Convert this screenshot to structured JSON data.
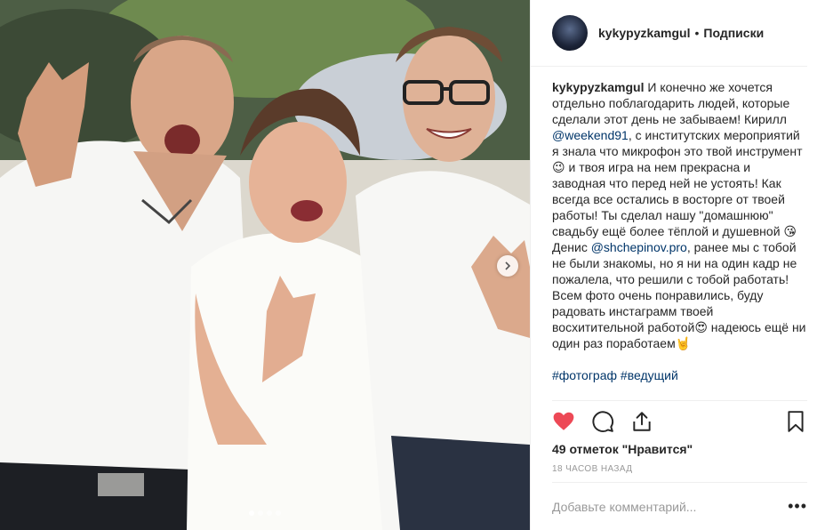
{
  "header": {
    "username": "kykypyzkamgul",
    "separator": "•",
    "follow_label": "Подписки"
  },
  "caption": {
    "username": "kykypyzkamgul",
    "part1": " И конечно же хочется отдельно поблагодарить людей, которые сделали этот день не забываем! Кирилл ",
    "mention1": "@weekend91",
    "part2": ", с институтских мероприятий я знала что микрофон это твой инструмент😉 и твоя игра на нем прекрасна и заводная что перед ней не устоять! Как всегда все остались в восторге от твоей работы! Ты сделал нашу \"домашнюю\" свадьбу ещё более тёплой и душевной 😘\nДенис ",
    "mention2": "@shchepinov.pro",
    "part3": ", ранее мы с тобой не были знакомы, но я ни на один кадр не пожалела, что решили с тобой работать! Всем фото очень понравились, буду радовать инстаграмм твоей восхитительной работой😍 надеюсь ещё ни один раз поработаем🤘\n\n",
    "hashtags": "#фотограф #ведущий"
  },
  "actions": {
    "like_icon": "heart-filled-icon",
    "comment_icon": "comment-bubble-icon",
    "share_icon": "share-icon",
    "save_icon": "bookmark-icon",
    "like_color": "#ed4956"
  },
  "likes_text": "49 отметок \"Нравится\"",
  "timestamp": "18 ЧАСОВ НАЗАД",
  "comment": {
    "placeholder": "Добавьте комментарий...",
    "more_label": "•••"
  },
  "carousel": {
    "slides": 4,
    "active": 1,
    "next_icon": "chevron-right-icon"
  }
}
